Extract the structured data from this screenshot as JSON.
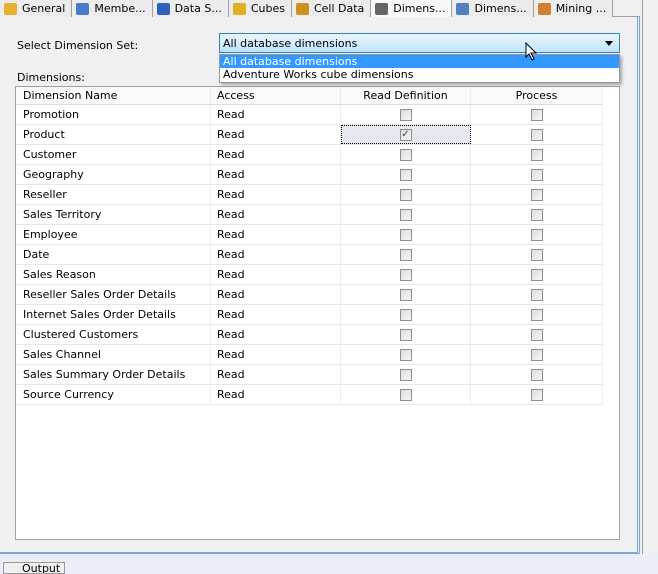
{
  "tabs": [
    {
      "label": "General",
      "color": "#e8b030"
    },
    {
      "label": "Membe...",
      "color": "#4a7bc8"
    },
    {
      "label": "Data S...",
      "color": "#3060c0"
    },
    {
      "label": "Cubes",
      "color": "#e0b020"
    },
    {
      "label": "Cell Data",
      "color": "#d09020"
    },
    {
      "label": "Dimens...",
      "color": "#666666"
    },
    {
      "label": "Dimens...",
      "color": "#5080c0"
    },
    {
      "label": "Mining ...",
      "color": "#d08030"
    }
  ],
  "active_tab": 5,
  "select_label": "Select Dimension Set:",
  "combo_value": "All database dimensions",
  "options": [
    "All database dimensions",
    "Adventure Works cube dimensions"
  ],
  "dimensions_label": "Dimensions:",
  "columns": [
    "Dimension Name",
    "Access",
    "Read Definition",
    "Process"
  ],
  "rows": [
    {
      "name": "Promotion",
      "access": "Read",
      "read_def": false,
      "process": false
    },
    {
      "name": "Product",
      "access": "Read",
      "read_def": true,
      "process": false
    },
    {
      "name": "Customer",
      "access": "Read",
      "read_def": false,
      "process": false
    },
    {
      "name": "Geography",
      "access": "Read",
      "read_def": false,
      "process": false
    },
    {
      "name": "Reseller",
      "access": "Read",
      "read_def": false,
      "process": false
    },
    {
      "name": "Sales Territory",
      "access": "Read",
      "read_def": false,
      "process": false
    },
    {
      "name": "Employee",
      "access": "Read",
      "read_def": false,
      "process": false
    },
    {
      "name": "Date",
      "access": "Read",
      "read_def": false,
      "process": false
    },
    {
      "name": "Sales Reason",
      "access": "Read",
      "read_def": false,
      "process": false
    },
    {
      "name": "Reseller Sales Order Details",
      "access": "Read",
      "read_def": false,
      "process": false
    },
    {
      "name": "Internet Sales Order Details",
      "access": "Read",
      "read_def": false,
      "process": false
    },
    {
      "name": "Clustered Customers",
      "access": "Read",
      "read_def": false,
      "process": false
    },
    {
      "name": "Sales Channel",
      "access": "Read",
      "read_def": false,
      "process": false
    },
    {
      "name": "Sales Summary Order Details",
      "access": "Read",
      "read_def": false,
      "process": false
    },
    {
      "name": "Source Currency",
      "access": "Read",
      "read_def": false,
      "process": false
    }
  ],
  "output_tab": "Output"
}
